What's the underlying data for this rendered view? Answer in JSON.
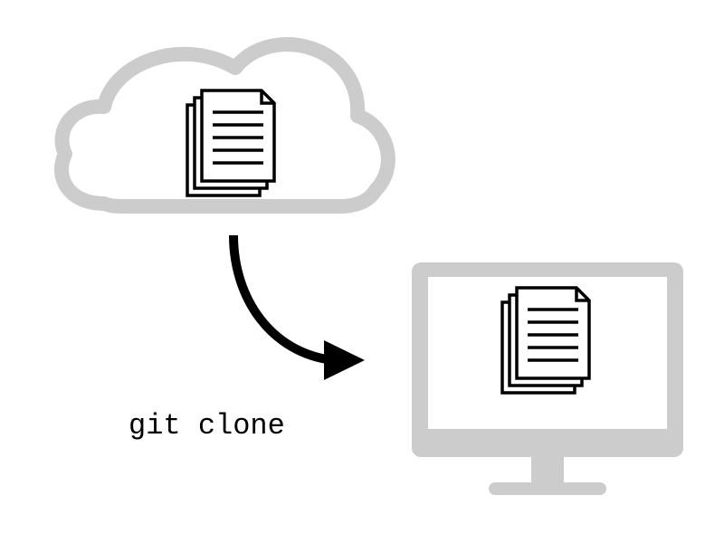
{
  "command": "git clone",
  "icons": {
    "source": "cloud-with-documents",
    "destination": "monitor-with-documents",
    "connector": "curved-arrow"
  }
}
